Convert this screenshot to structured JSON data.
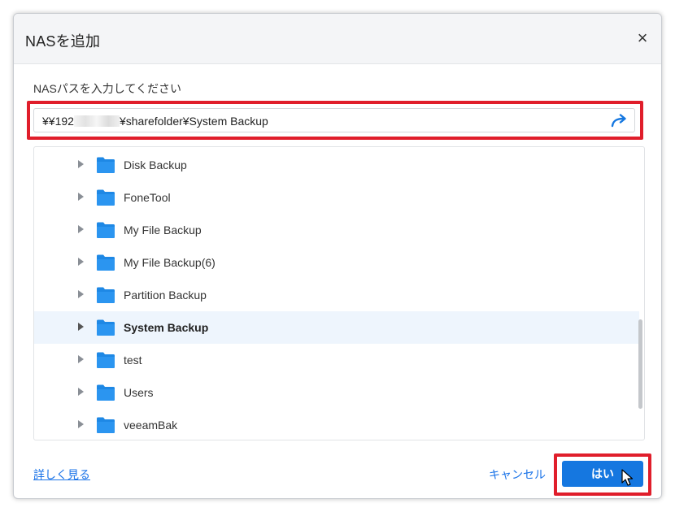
{
  "dialog": {
    "title": "NASを追加",
    "close_label": "×"
  },
  "path": {
    "label": "NASパスを入力してください",
    "prefix": "¥¥192",
    "suffix": "¥sharefolder¥System Backup"
  },
  "tree": {
    "items": [
      {
        "label": "Disk Backup",
        "selected": false
      },
      {
        "label": "FoneTool",
        "selected": false
      },
      {
        "label": "My File Backup",
        "selected": false
      },
      {
        "label": "My File Backup(6)",
        "selected": false
      },
      {
        "label": "Partition Backup",
        "selected": false
      },
      {
        "label": "System Backup",
        "selected": true
      },
      {
        "label": "test",
        "selected": false
      },
      {
        "label": "Users",
        "selected": false
      },
      {
        "label": "veeamBak",
        "selected": false
      }
    ]
  },
  "footer": {
    "learn_more": "詳しく見る",
    "cancel": "キャンセル",
    "ok": "はい"
  },
  "colors": {
    "accent": "#1577e0",
    "link": "#1a73e8",
    "highlight": "#e01e2b",
    "folder": "#1e88e5",
    "selected_row": "#eef5fd"
  },
  "icons": {
    "folder": "folder-icon",
    "expand": "chevron-right-icon",
    "go": "redo-arrow-icon",
    "close": "close-icon"
  }
}
